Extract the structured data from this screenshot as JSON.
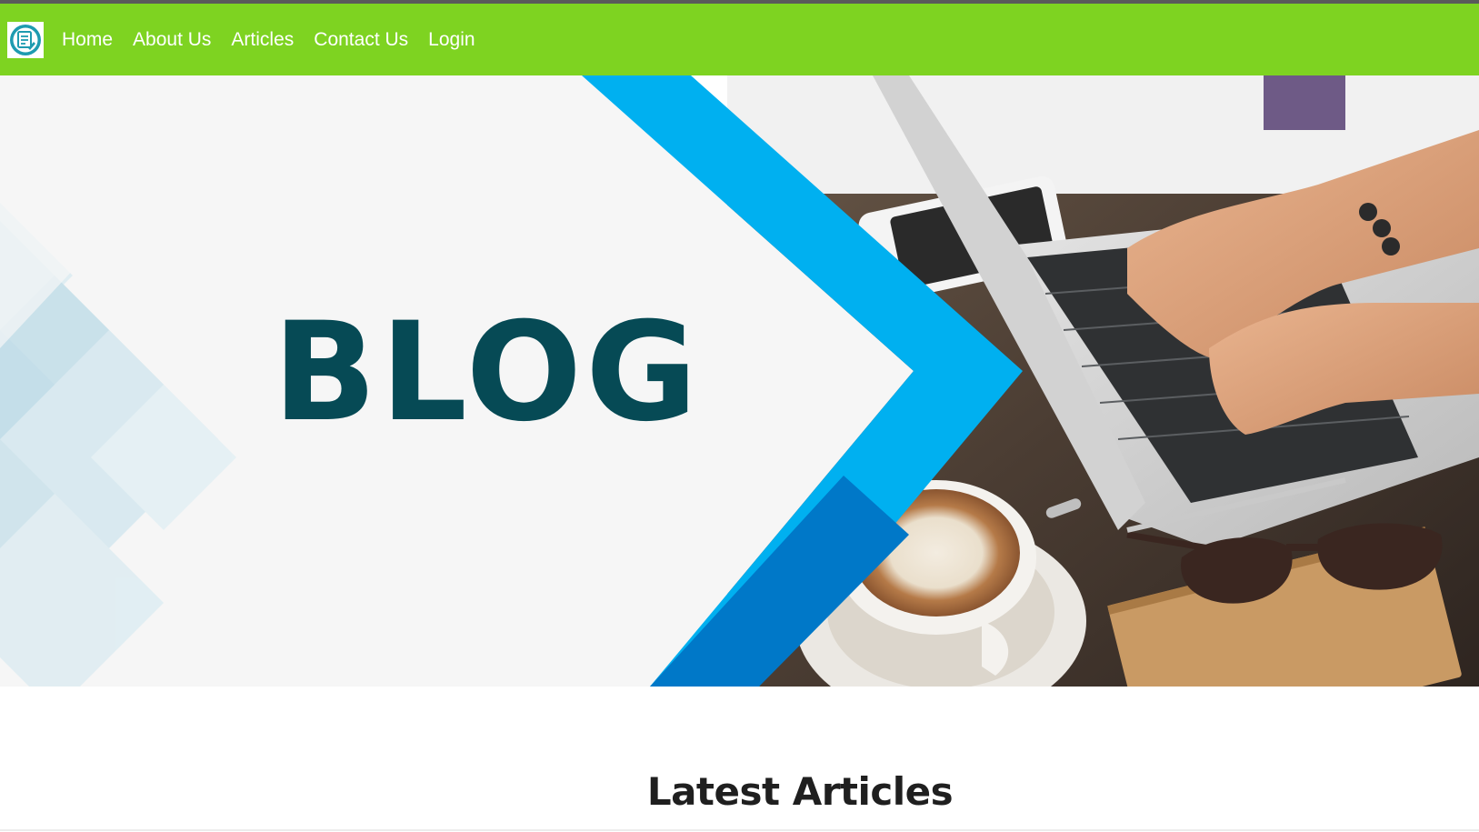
{
  "colors": {
    "navbar_bg": "#7ed321",
    "accent_blue": "#00b0f0",
    "accent_blue_dark": "#0078c8",
    "blog_text": "#064a55",
    "logo_teal": "#1e9bb0"
  },
  "logo": {
    "icon": "document-pen-icon"
  },
  "nav": {
    "items": [
      {
        "label": "Home"
      },
      {
        "label": "About Us"
      },
      {
        "label": "Articles"
      },
      {
        "label": "Contact Us"
      },
      {
        "label": "Login"
      }
    ]
  },
  "hero": {
    "title": "BLOG",
    "image_subject": "laptop-typing-coffee-glasses"
  },
  "main": {
    "section_title": "Latest Articles"
  }
}
